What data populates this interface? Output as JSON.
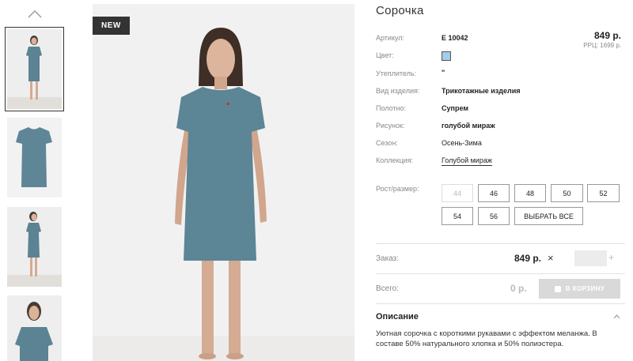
{
  "gallery": {
    "badge": "NEW",
    "thumbnails": [
      {
        "name": "thumb-model-front",
        "active": true
      },
      {
        "name": "thumb-dress-flat",
        "active": false
      },
      {
        "name": "thumb-model-side",
        "active": false
      },
      {
        "name": "thumb-model-closeup",
        "active": false
      }
    ]
  },
  "product": {
    "title": "Сорочка",
    "price": "849 р.",
    "rrp": "РРЦ: 1699 р.",
    "attributes": {
      "article_label": "Артикул:",
      "article_value": "E 10042",
      "color_label": "Цвет:",
      "color_hex": "#a3cde9",
      "insulation_label": "Утеплитель:",
      "insulation_value": "\"",
      "type_label": "Вид изделия:",
      "type_value": "Трикотажные изделия",
      "fabric_label": "Полотно:",
      "fabric_value": "Супрем",
      "pattern_label": "Рисунок:",
      "pattern_value": "голубой мираж",
      "season_label": "Сезон:",
      "season_value": "Осень-Зима",
      "collection_label": "Коллекция:",
      "collection_value": "Голубой мираж"
    }
  },
  "sizes": {
    "label": "Рост/размер:",
    "options": [
      "44",
      "46",
      "48",
      "50",
      "52",
      "54",
      "56"
    ],
    "select_all": "ВЫБРАТЬ ВСЕ"
  },
  "order": {
    "label": "Заказ:",
    "price": "849 р.",
    "multiply": "×",
    "plus": "+",
    "total_label": "Всего:",
    "total_value": "0 р.",
    "cart_button": "В КОРЗИНУ"
  },
  "description": {
    "heading": "Описание",
    "text": "Уютная сорочка с короткими рукавами с эффектом меланжа. В составе 50% натурального хлопка и 50% полиэстера."
  }
}
